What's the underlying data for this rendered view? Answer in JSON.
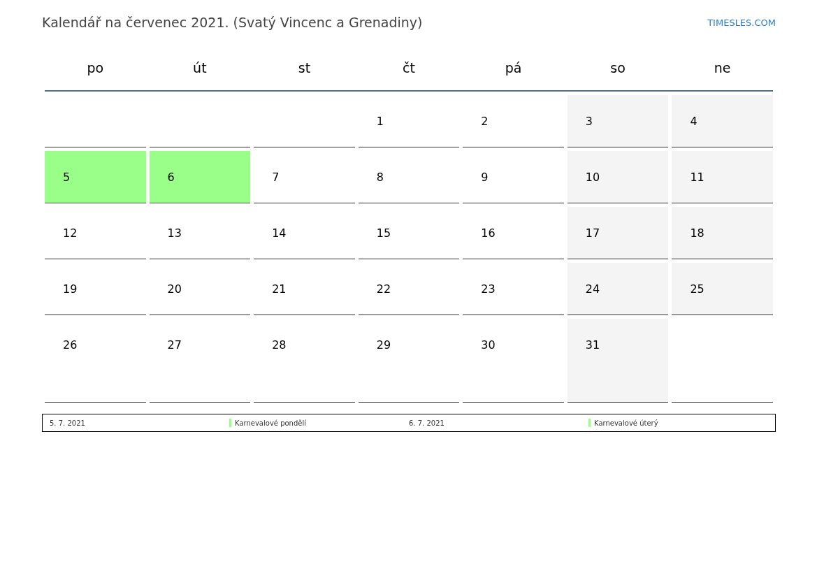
{
  "title": "Kalendář na červenec 2021. (Svatý Vincenc a Grenadiny)",
  "site_link": "TIMESLES.COM",
  "weekdays": [
    "po",
    "út",
    "st",
    "čt",
    "pá",
    "so",
    "ne"
  ],
  "weeks": [
    [
      {
        "kind": "empty"
      },
      {
        "kind": "empty"
      },
      {
        "kind": "empty"
      },
      {
        "kind": "weekday",
        "day": "1"
      },
      {
        "kind": "weekday",
        "day": "2"
      },
      {
        "kind": "weekend",
        "day": "3"
      },
      {
        "kind": "weekend",
        "day": "4"
      }
    ],
    [
      {
        "kind": "holiday",
        "day": "5"
      },
      {
        "kind": "holiday",
        "day": "6"
      },
      {
        "kind": "weekday",
        "day": "7"
      },
      {
        "kind": "weekday",
        "day": "8"
      },
      {
        "kind": "weekday",
        "day": "9"
      },
      {
        "kind": "weekend",
        "day": "10"
      },
      {
        "kind": "weekend",
        "day": "11"
      }
    ],
    [
      {
        "kind": "weekday",
        "day": "12"
      },
      {
        "kind": "weekday",
        "day": "13"
      },
      {
        "kind": "weekday",
        "day": "14"
      },
      {
        "kind": "weekday",
        "day": "15"
      },
      {
        "kind": "weekday",
        "day": "16"
      },
      {
        "kind": "weekend",
        "day": "17"
      },
      {
        "kind": "weekend",
        "day": "18"
      }
    ],
    [
      {
        "kind": "weekday",
        "day": "19"
      },
      {
        "kind": "weekday",
        "day": "20"
      },
      {
        "kind": "weekday",
        "day": "21"
      },
      {
        "kind": "weekday",
        "day": "22"
      },
      {
        "kind": "weekday",
        "day": "23"
      },
      {
        "kind": "weekend",
        "day": "24"
      },
      {
        "kind": "weekend",
        "day": "25"
      }
    ],
    [
      {
        "kind": "weekday",
        "day": "26"
      },
      {
        "kind": "weekday",
        "day": "27"
      },
      {
        "kind": "weekday",
        "day": "28"
      },
      {
        "kind": "weekday",
        "day": "29"
      },
      {
        "kind": "weekday",
        "day": "30"
      },
      {
        "kind": "weekend",
        "day": "31"
      },
      {
        "kind": "empty"
      }
    ]
  ],
  "legend": [
    {
      "date": "5. 7. 2021",
      "name": "Karnevalové pondělí",
      "color": "#99ff88"
    },
    {
      "date": "6. 7. 2021",
      "name": "Karnevalové úterý",
      "color": "#99ff88"
    }
  ]
}
